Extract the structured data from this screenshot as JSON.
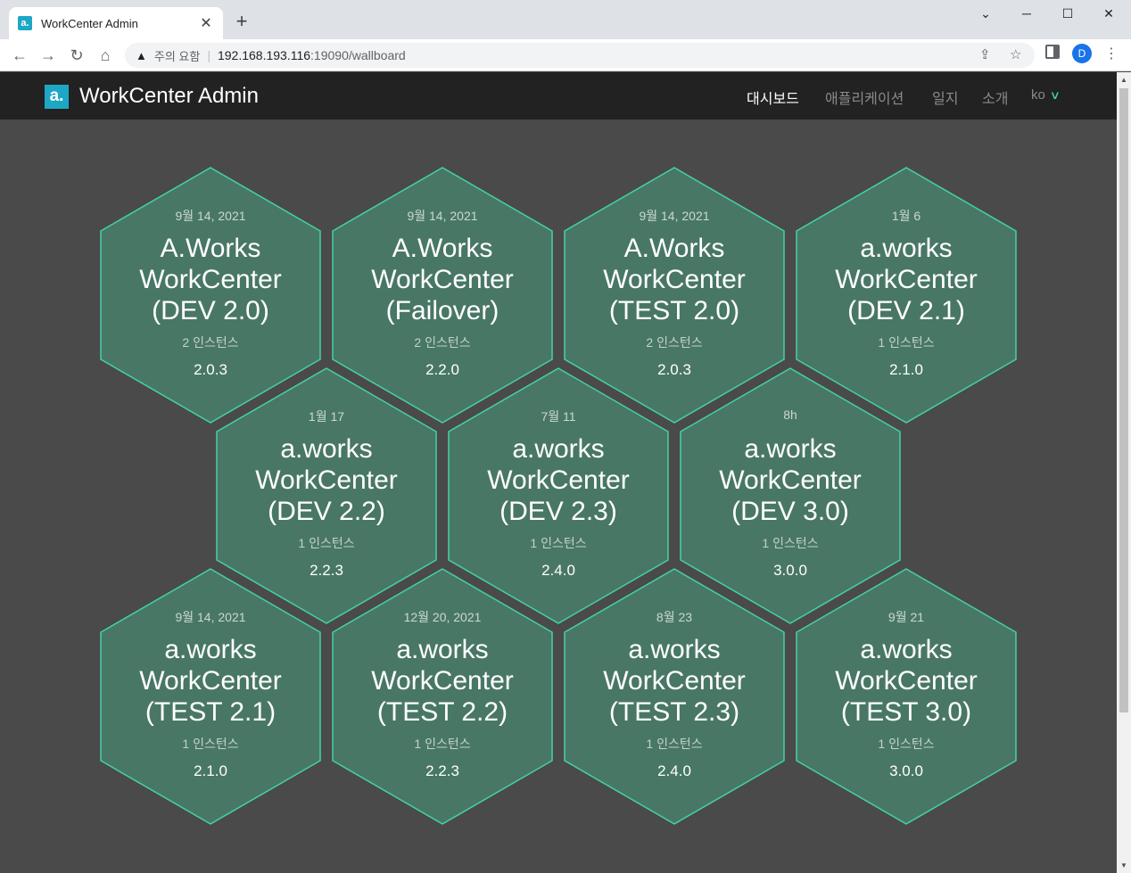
{
  "browser": {
    "tab_title": "WorkCenter Admin",
    "favicon_text": "a.",
    "new_tab_symbol": "+",
    "security_label": "주의 요함",
    "url_host": "192.168.193.116",
    "url_path": ":19090/wallboard",
    "profile_initial": "D"
  },
  "app": {
    "logo_text": "a.",
    "title": "WorkCenter Admin",
    "nav": [
      "대시보드",
      "애플리케이션",
      "일지",
      "소개"
    ],
    "language": "ko"
  },
  "colors": {
    "hex_fill": "#497766",
    "hex_border": "#42d3a5",
    "background": "#4a4a4a",
    "navbar": "#222222"
  },
  "applications": [
    {
      "date": "9월 14, 2021",
      "name": "A.Works WorkCenter (DEV 2.0)",
      "instances": "2 인스턴스",
      "version": "2.0.3"
    },
    {
      "date": "9월 14, 2021",
      "name": "A.Works WorkCenter (Failover)",
      "instances": "2 인스턴스",
      "version": "2.2.0"
    },
    {
      "date": "9월 14, 2021",
      "name": "A.Works WorkCenter (TEST 2.0)",
      "instances": "2 인스턴스",
      "version": "2.0.3"
    },
    {
      "date": "1월 6",
      "name": "a.works WorkCenter (DEV 2.1)",
      "instances": "1 인스턴스",
      "version": "2.1.0"
    },
    {
      "date": "1월 17",
      "name": "a.works WorkCenter (DEV 2.2)",
      "instances": "1 인스턴스",
      "version": "2.2.3"
    },
    {
      "date": "7월 11",
      "name": "a.works WorkCenter (DEV 2.3)",
      "instances": "1 인스턴스",
      "version": "2.4.0"
    },
    {
      "date": "8h",
      "name": "a.works WorkCenter (DEV 3.0)",
      "instances": "1 인스턴스",
      "version": "3.0.0"
    },
    {
      "date": "9월 14, 2021",
      "name": "a.works WorkCenter (TEST 2.1)",
      "instances": "1 인스턴스",
      "version": "2.1.0"
    },
    {
      "date": "12월 20, 2021",
      "name": "a.works WorkCenter (TEST 2.2)",
      "instances": "1 인스턴스",
      "version": "2.2.3"
    },
    {
      "date": "8월 23",
      "name": "a.works WorkCenter (TEST 2.3)",
      "instances": "1 인스턴스",
      "version": "2.4.0"
    },
    {
      "date": "9월 21",
      "name": "a.works WorkCenter (TEST 3.0)",
      "instances": "1 인스턴스",
      "version": "3.0.0"
    }
  ]
}
